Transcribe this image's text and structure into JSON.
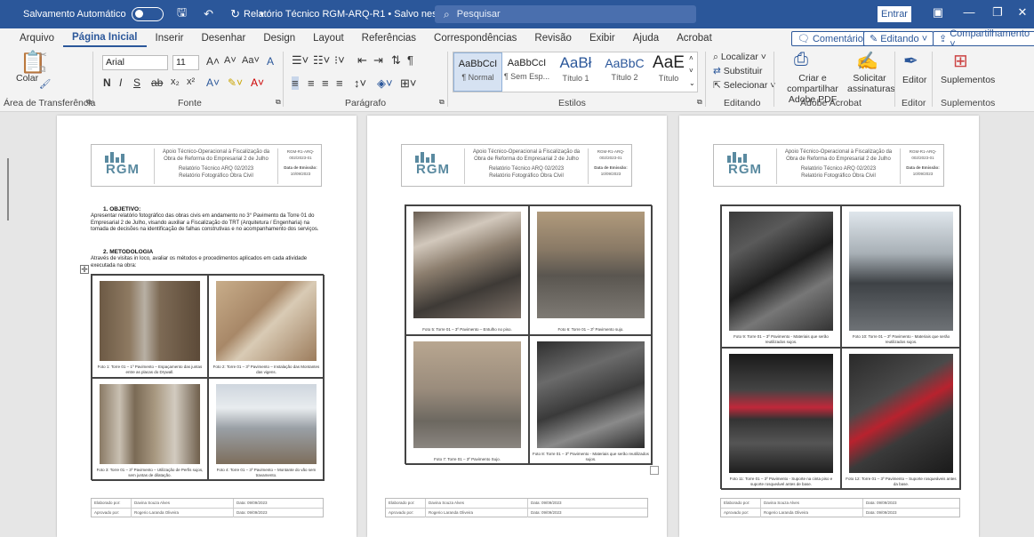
{
  "titlebar": {
    "autosave_label": "Salvamento Automático",
    "doc_title": "Relatório Técnico RGM-ARQ-R1 • Salvo neste PC ∨",
    "search_placeholder": "Pesquisar",
    "enter_label": "Entrar"
  },
  "tabs": [
    "Arquivo",
    "Página Inicial",
    "Inserir",
    "Desenhar",
    "Design",
    "Layout",
    "Referências",
    "Correspondências",
    "Revisão",
    "Exibir",
    "Ajuda",
    "Acrobat"
  ],
  "tab_actions": {
    "comments": "Comentários",
    "editing": "Editando ˅",
    "share": "Compartilhamento ˅"
  },
  "ribbon": {
    "paste_label": "Colar",
    "font_name": "Arial",
    "font_size": "11",
    "styles": [
      {
        "preview": "AaBbCcI",
        "label": "¶ Normal"
      },
      {
        "preview": "AaBbCcI",
        "label": "¶ Sem Esp..."
      },
      {
        "preview": "AaBł",
        "label": "Título 1"
      },
      {
        "preview": "AaBbC",
        "label": "Título 2"
      },
      {
        "preview": "AaE",
        "label": "Título"
      }
    ],
    "find_label": "Localizar ˅",
    "replace_label": "Substituir",
    "select_label": "Selecionar ˅",
    "create_share_pdf": "Criar e compartilhar Adobe PDF",
    "request_signatures": "Solicitar assinaturas",
    "editor_label": "Editor",
    "addins_label": "Suplementos",
    "groups": [
      "Área de Transferência",
      "Fonte",
      "Parágrafo",
      "Estilos",
      "Editando",
      "Adobe Acrobat",
      "Editor",
      "Suplementos"
    ]
  },
  "doc_header": {
    "title_line1": "Apoio Técnico-Operacional à Fiscalização da",
    "title_line2": "Obra de Reforma do Empresarial 2 de Julho",
    "report_line1": "Relatório Técnico ARQ 02/2023",
    "report_line2": "Relatório Fotográfico Obra Civil",
    "doc_code": "RGM-R1-ARQ-002/2023-01",
    "emission_label": "Data de Emissão:",
    "emission_date": "10/09/2023",
    "logo_text": "RGM"
  },
  "page1": {
    "sec1_title": "1.   OBJETIVO:",
    "sec1_text": "Apresentar relatório fotográfico das obras civis em andamento no 3° Pavimento da Torre 01 do Empresarial 2 de Julho, visando auxiliar a Fiscalização do TRT (Arquitetura / Engenharia) na tomada de decisões na identificação de falhas construtivas e no acompanhamento dos serviços.",
    "sec2_title": "2.   METODOLOGIA",
    "sec2_text": "Através de visitas in loco, avaliar os métodos e procedimentos aplicados em cada atividade executada na obra:",
    "captions": [
      "Foto 1: Torre 01 – 1º Pavimento – Espaçamento das juntas entre as placas do Drywall.",
      "Foto 2: Torre 01 – 3º Pavimento – Instalação das Montantes das vigens.",
      "Foto 3: Torre 01 – 3º Pavimento – Utilização de Perfis sujos, sem juntas de dilatação.",
      "Foto 4: Torre 01 – 3º Pavimento – Montante do vão sem travamento."
    ]
  },
  "page2": {
    "captions": [
      "Foto 5: Torre 01 – 3º Pavimento – Entulho no piso.",
      "Foto 6: Torre 01 – 3º Pavimento sujo.",
      "Foto 7: Torre 01 – 3º Pavimento Sujo.",
      "Foto 8: Torre 01 – 3º Pavimento - Materiais que serão reutilizados sujos."
    ]
  },
  "page3": {
    "captions": [
      "Foto 9: Torre 01 – 3º Pavimento - Materiais que serão reutilizados sujos.",
      "Foto 10: Torre 01 – 3º Pavimento - Materiais que serão reutilizados sujos.",
      "Foto 11: Torre 01 – 3º Pavimento - Suporte na cinta piso e suporte rosqueável antes de base.",
      "Foto 12: Torre 01 – 3º Pavimento – Suporte rosqueáveis antes da base."
    ]
  },
  "footer": {
    "prepared_label": "Elaborado por:",
    "prepared_name": "Davina Souza Alves",
    "approved_label": "Aprovado por:",
    "approved_name": "Rogerio Laranda Oliveira",
    "date_text": "Data: 09/09/2023"
  }
}
